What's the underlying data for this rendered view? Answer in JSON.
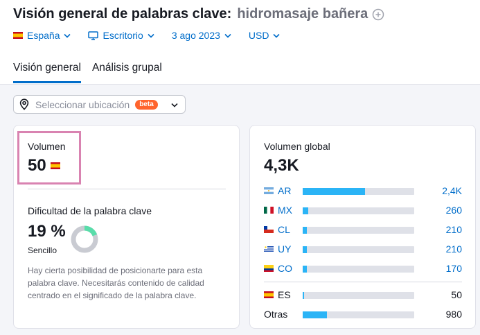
{
  "header": {
    "title": "Visión general de palabras clave:",
    "keyword": "hidromasaje bañera"
  },
  "filters": {
    "country": "España",
    "device": "Escritorio",
    "date": "3 ago 2023",
    "currency": "USD"
  },
  "tabs": [
    {
      "label": "Visión general",
      "active": true
    },
    {
      "label": "Análisis grupal",
      "active": false
    }
  ],
  "location": {
    "placeholder": "Seleccionar ubicación",
    "badge": "beta"
  },
  "volume": {
    "label": "Volumen",
    "value": "50",
    "flag": "es-flag-icon"
  },
  "keyword_difficulty": {
    "label": "Dificultad de la palabra clave",
    "value": "19 %",
    "percent": 19,
    "level": "Sencillo",
    "description": "Hay cierta posibilidad de posicionarte para esta palabra clave. Necesitarás contenido de calidad centrado en el significado de la palabra clave.",
    "color": "#59ddaa"
  },
  "global_volume": {
    "label": "Volumen global",
    "value": "4,3K",
    "countries": [
      {
        "code": "AR",
        "value": "2,4K",
        "share": 0.56,
        "flag": "ar-flag-icon",
        "link": true
      },
      {
        "code": "MX",
        "value": "260",
        "share": 0.05,
        "flag": "mx-flag-icon",
        "link": true
      },
      {
        "code": "CL",
        "value": "210",
        "share": 0.04,
        "flag": "cl-flag-icon",
        "link": true
      },
      {
        "code": "UY",
        "value": "210",
        "share": 0.04,
        "flag": "uy-flag-icon",
        "link": true
      },
      {
        "code": "CO",
        "value": "170",
        "share": 0.04,
        "flag": "co-flag-icon",
        "link": true
      }
    ],
    "current": {
      "code": "ES",
      "value": "50",
      "share": 0.015,
      "flag": "es-flag-icon"
    },
    "others": {
      "label": "Otras",
      "value": "980",
      "share": 0.22
    }
  },
  "colors": {
    "accent": "#006dca",
    "bar": "#2bb4f6",
    "highlight": "#d983b1",
    "beta": "#ff642d"
  }
}
